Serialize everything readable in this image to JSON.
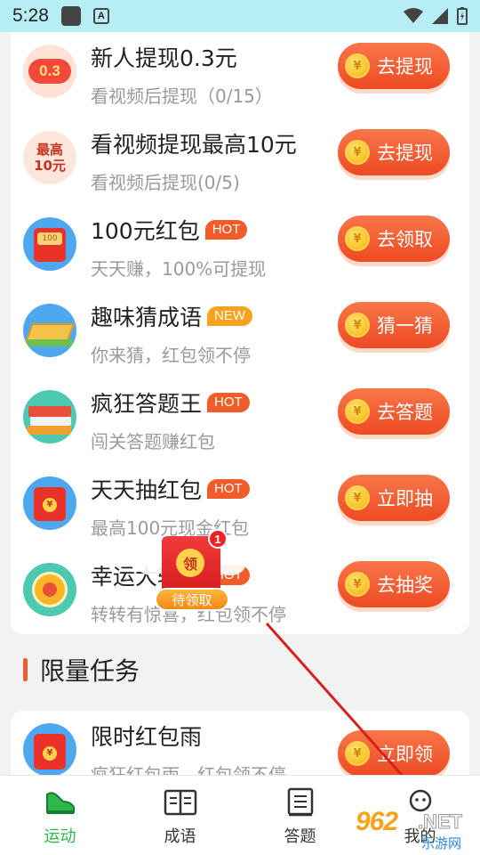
{
  "status_bar": {
    "time": "5:28",
    "notif_letter": "A"
  },
  "tasks": [
    {
      "title": "新人提现0.3元",
      "badge": "",
      "subtitle": "看视频后提现（0/15）",
      "button": "去提现",
      "icon": "cash-0.3-icon",
      "icon_text": "0.3"
    },
    {
      "title": "看视频提现最高10元",
      "badge": "",
      "subtitle": "看视频后提现(0/5)",
      "button": "去提现",
      "icon": "max-10-yuan-icon",
      "icon_text": "最高\n10元"
    },
    {
      "title": "100元红包",
      "badge": "HOT",
      "subtitle": "天天赚，100%可提现",
      "button": "去领取",
      "icon": "red-envelope-100-icon",
      "icon_text": "100"
    },
    {
      "title": "趣味猜成语",
      "badge": "NEW",
      "subtitle": "你来猜，红包领不停",
      "button": "猜一猜",
      "icon": "idiom-board-icon",
      "icon_text": ""
    },
    {
      "title": "疯狂答题王",
      "badge": "HOT",
      "subtitle": "闯关答题赚红包",
      "button": "去答题",
      "icon": "books-icon",
      "icon_text": ""
    },
    {
      "title": "天天抽红包",
      "badge": "HOT",
      "subtitle": "最高100元现金红包",
      "button": "立即抽",
      "icon": "red-envelope-icon",
      "icon_text": "¥"
    },
    {
      "title": "幸运大转盘",
      "badge": "HOT",
      "subtitle": "转转有惊喜，红包领不停",
      "button": "去抽奖",
      "icon": "lucky-wheel-icon",
      "icon_text": ""
    }
  ],
  "section": {
    "title": "限量任务"
  },
  "limited_task": {
    "title": "限时红包雨",
    "subtitle": "疯狂红包雨，红包领不停",
    "button": "立即领",
    "icon": "red-envelope-rain-icon",
    "icon_text": "¥"
  },
  "coin_symbol": "¥",
  "float_envelope": {
    "seal": "领",
    "count": "1",
    "label": "待领取"
  },
  "tabs": [
    {
      "label": "运动",
      "icon": "sneaker-icon",
      "active": true
    },
    {
      "label": "成语",
      "icon": "open-book-icon",
      "active": false
    },
    {
      "label": "答题",
      "icon": "answer-book-icon",
      "active": false
    },
    {
      "label": "我的",
      "icon": "profile-icon",
      "active": false
    }
  ],
  "watermark": {
    "big": "962",
    "net": ".NET",
    "sub": "乐游网"
  },
  "colors": {
    "accent": "#f25c2a",
    "active_tab": "#2db84c",
    "status_bar": "#b7eef5"
  }
}
